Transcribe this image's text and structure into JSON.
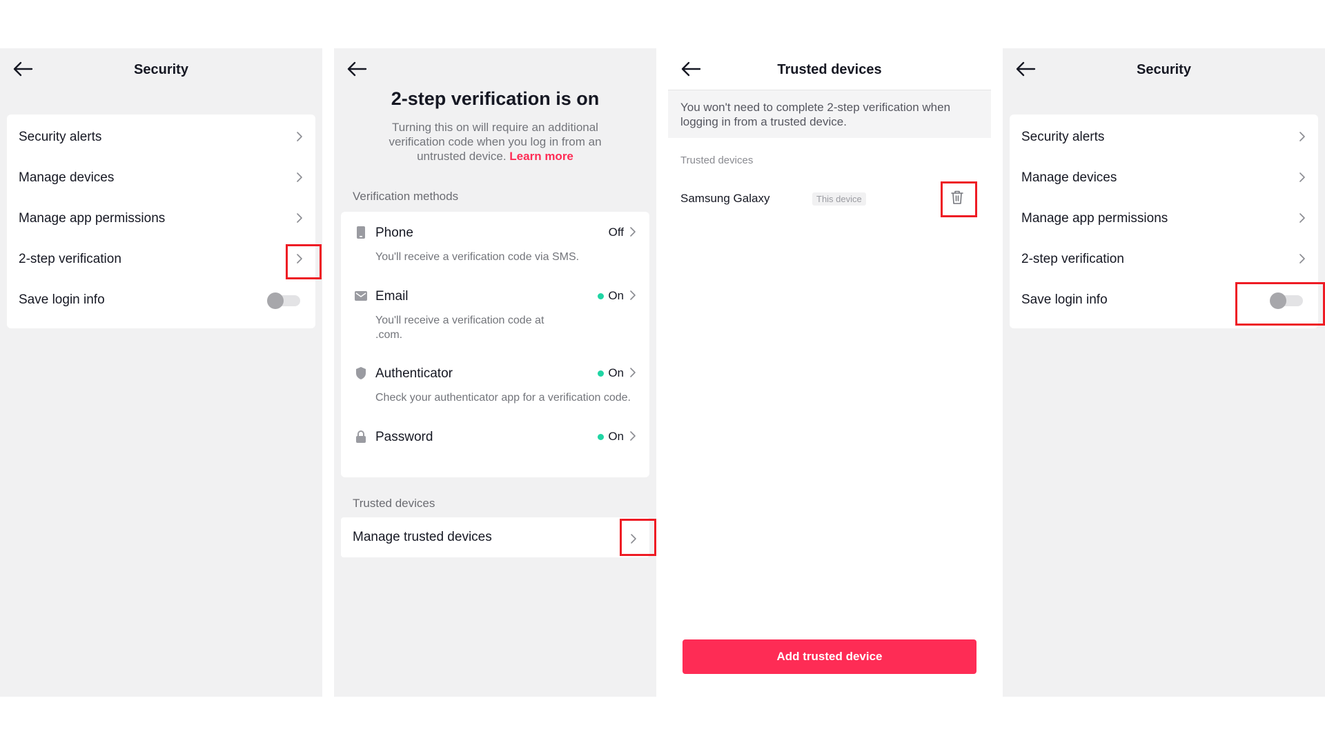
{
  "panel1": {
    "title": "Security",
    "items": [
      {
        "label": "Security alerts"
      },
      {
        "label": "Manage devices"
      },
      {
        "label": "Manage app permissions"
      },
      {
        "label": "2-step verification"
      },
      {
        "label": "Save login info",
        "toggle": false
      }
    ]
  },
  "panel2": {
    "title": "2-step verification is on",
    "description": "Turning this on will require an additional verification code when you log in from an untrusted device.",
    "learn_more": "Learn more",
    "methods_label": "Verification methods",
    "methods": [
      {
        "name": "Phone",
        "status": "Off",
        "desc": "You'll receive a verification code via SMS.",
        "icon": "phone-icon"
      },
      {
        "name": "Email",
        "status": "On",
        "desc": "You'll receive a verification code at .com.",
        "icon": "mail-icon"
      },
      {
        "name": "Authenticator",
        "status": "On",
        "desc": "Check your authenticator app for a verification code.",
        "icon": "shield-icon"
      },
      {
        "name": "Password",
        "status": "On",
        "desc": "",
        "icon": "lock-icon"
      }
    ],
    "trusted_label": "Trusted devices",
    "manage_trusted": "Manage trusted devices"
  },
  "panel3": {
    "title": "Trusted devices",
    "info": "You won't need to complete 2-step verification when logging in from a trusted device.",
    "list_label": "Trusted devices",
    "device_name": "Samsung Galaxy",
    "device_badge": "This device",
    "add_button": "Add trusted device"
  },
  "panel4": {
    "title": "Security",
    "items": [
      {
        "label": "Security alerts"
      },
      {
        "label": "Manage devices"
      },
      {
        "label": "Manage app permissions"
      },
      {
        "label": "2-step verification"
      },
      {
        "label": "Save login info",
        "toggle": false
      }
    ]
  },
  "colors": {
    "accent": "#fe2c55",
    "status_on": "#20d5a4",
    "highlight": "#ee1b24"
  }
}
